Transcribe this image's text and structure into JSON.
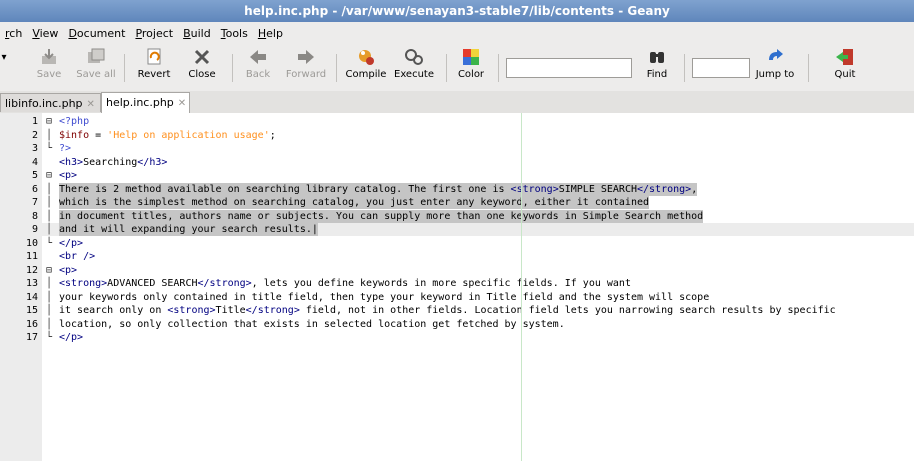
{
  "window": {
    "title": "help.inc.php - /var/www/senayan3-stable7/lib/contents - Geany"
  },
  "menu": [
    "rch",
    "View",
    "Document",
    "Project",
    "Build",
    "Tools",
    "Help"
  ],
  "toolbar": {
    "save": "Save",
    "save_all": "Save all",
    "revert": "Revert",
    "close": "Close",
    "back": "Back",
    "forward": "Forward",
    "compile": "Compile",
    "execute": "Execute",
    "color": "Color",
    "find": "Find",
    "jump_to": "Jump to",
    "quit": "Quit",
    "search_value": "",
    "jump_value": ""
  },
  "tabs": [
    {
      "label": "libinfo.inc.php",
      "active": false
    },
    {
      "label": "help.inc.php",
      "active": true
    }
  ],
  "editor": {
    "lines": [
      {
        "n": "1",
        "fold": "⊟",
        "html": "<span class='php'>&lt;?php</span>"
      },
      {
        "n": "2",
        "fold": "│",
        "html": "<span class='var'>$info</span> = <span class='str'>'Help on application usage'</span>;"
      },
      {
        "n": "3",
        "fold": "└",
        "html": "<span class='php'>?&gt;</span>"
      },
      {
        "n": "4",
        "fold": "",
        "html": "<span class='tag'>&lt;h3&gt;</span>Searching<span class='tag'>&lt;/h3&gt;</span>"
      },
      {
        "n": "5",
        "fold": "⊟",
        "html": "<span class='tag'>&lt;p&gt;</span>"
      },
      {
        "n": "6",
        "fold": "│",
        "sel": true,
        "html": "There is 2 method available on searching library catalog. The first one is <span class='tag'>&lt;strong&gt;</span>SIMPLE SEARCH<span class='tag'>&lt;/strong&gt;</span>,"
      },
      {
        "n": "7",
        "fold": "│",
        "sel": true,
        "html": "which is the simplest method on searching catalog, you just enter any keyword, either it contained"
      },
      {
        "n": "8",
        "fold": "│",
        "sel": true,
        "html": "in document titles, authors name or subjects. You can supply more than one keywords in Simple Search method"
      },
      {
        "n": "9",
        "fold": "│",
        "sel": true,
        "cur": true,
        "html": "and it will expanding your search results.|"
      },
      {
        "n": "10",
        "fold": "└",
        "html": "<span class='tag'>&lt;/p&gt;</span>"
      },
      {
        "n": "11",
        "fold": "",
        "html": "<span class='tag'>&lt;br /&gt;</span>"
      },
      {
        "n": "12",
        "fold": "⊟",
        "html": "<span class='tag'>&lt;p&gt;</span>"
      },
      {
        "n": "13",
        "fold": "│",
        "html": "<span class='tag'>&lt;strong&gt;</span>ADVANCED SEARCH<span class='tag'>&lt;/strong&gt;</span>, lets you define keywords in more specific fields. If you want"
      },
      {
        "n": "14",
        "fold": "│",
        "html": "your keywords only contained in title field, then type your keyword in Title field and the system will scope"
      },
      {
        "n": "15",
        "fold": "│",
        "html": "it search only on <span class='tag'>&lt;strong&gt;</span>Title<span class='tag'>&lt;/strong&gt;</span> field, not in other fields. Location field lets you narrowing search results by specific"
      },
      {
        "n": "16",
        "fold": "│",
        "html": "location, so only collection that exists in selected location get fetched by system."
      },
      {
        "n": "17",
        "fold": "└",
        "html": "<span class='tag'>&lt;/p&gt;</span>"
      }
    ]
  },
  "colors": {
    "titlebar": "#6d92c4",
    "selection": "#c5c5c5",
    "tag": "#000080",
    "string": "#ff901e",
    "variable": "#7f0000"
  }
}
